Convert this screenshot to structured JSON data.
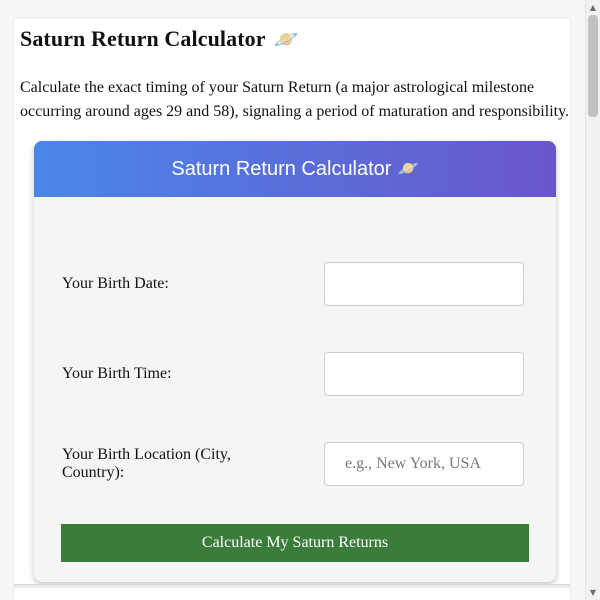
{
  "page": {
    "title": "Saturn Return Calculator",
    "title_icon": "🪐",
    "intro": "Calculate the exact timing of your Saturn Return (a major astrological milestone occurring around ages 29 and 58), signaling a period of maturation and responsibility."
  },
  "calculator": {
    "header_title": "Saturn Return Calculator",
    "header_icon": "🪐",
    "fields": {
      "birth_date": {
        "label": "Your Birth Date:",
        "value": "",
        "placeholder": ""
      },
      "birth_time": {
        "label": "Your Birth Time:",
        "value": "",
        "placeholder": ""
      },
      "birth_location": {
        "label": "Your Birth Location (City, Country):",
        "value": "",
        "placeholder": "e.g., New York, USA"
      }
    },
    "submit_label": "Calculate My Saturn Returns"
  },
  "scrollbar": {
    "up_arrow": "▲",
    "down_arrow": "▼"
  },
  "colors": {
    "header_start": "#4a86e8",
    "header_end": "#6a56cc",
    "submit_button": "#3a7d3a"
  },
  "icons": {
    "title_icon": "planet-icon",
    "header_icon": "planet-icon"
  }
}
